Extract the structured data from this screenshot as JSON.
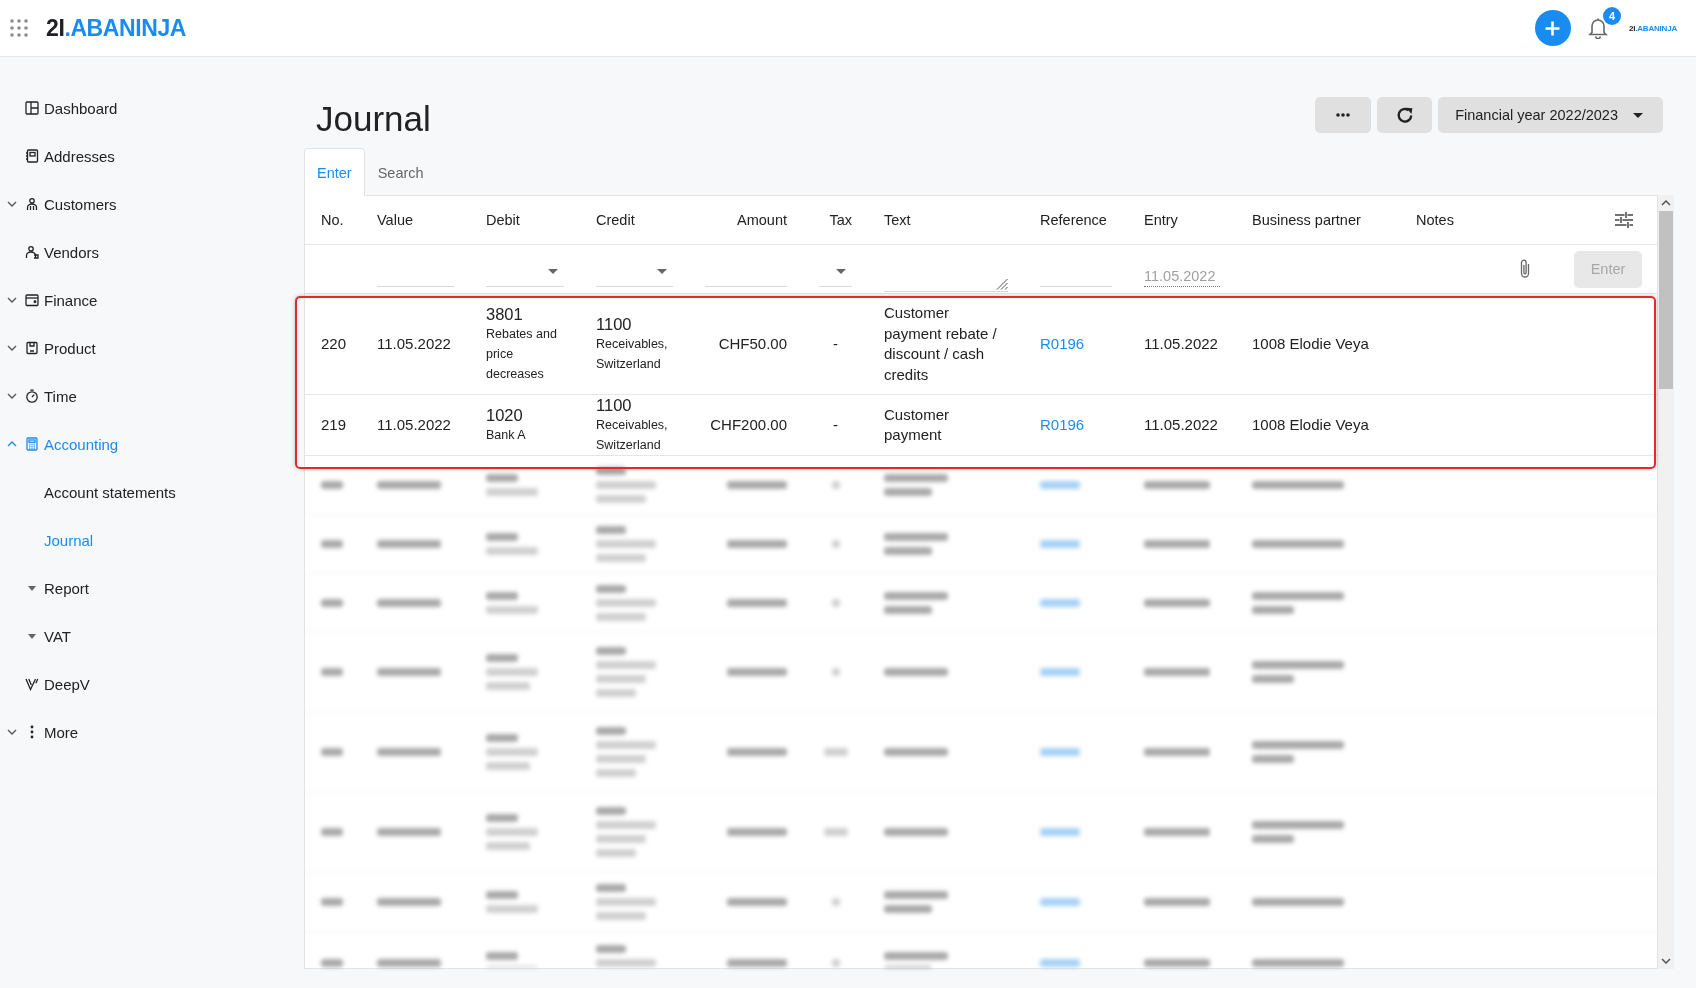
{
  "top_bar": {
    "logo": {
      "prefix": "2I",
      "suffix": ".ABANINJA"
    },
    "notification_count": "4",
    "account_logo": {
      "prefix": "2I",
      "suffix": ".ABANINJA"
    }
  },
  "sidebar": {
    "items": [
      {
        "kind": "link",
        "label": "Dashboard",
        "selected": false
      },
      {
        "kind": "link",
        "label": "Addresses",
        "selected": false
      },
      {
        "kind": "group",
        "label": "Customers",
        "expanded": false,
        "selected": false
      },
      {
        "kind": "link",
        "label": "Vendors",
        "selected": false
      },
      {
        "kind": "group",
        "label": "Finance",
        "expanded": false,
        "selected": false
      },
      {
        "kind": "group",
        "label": "Product",
        "expanded": false,
        "selected": false
      },
      {
        "kind": "group",
        "label": "Time",
        "expanded": false,
        "selected": false
      },
      {
        "kind": "group",
        "label": "Accounting",
        "expanded": true,
        "selected": true,
        "children": [
          {
            "kind": "link",
            "label": "Account statements",
            "selected": false
          },
          {
            "kind": "link",
            "label": "Journal",
            "selected": true
          },
          {
            "kind": "group",
            "label": "Report",
            "expanded": false,
            "selected": false
          },
          {
            "kind": "group",
            "label": "VAT",
            "expanded": false,
            "selected": false
          }
        ]
      },
      {
        "kind": "link",
        "label": "DeepV",
        "selected": false
      },
      {
        "kind": "group",
        "label": "More",
        "expanded": false,
        "selected": false
      }
    ]
  },
  "page": {
    "title": "Journal",
    "financial_year": "Financial year 2022/2023"
  },
  "tabs": [
    {
      "label": "Enter",
      "selected": true
    },
    {
      "label": "Search",
      "selected": false
    }
  ],
  "table": {
    "columns": [
      "No.",
      "Value",
      "Debit",
      "Credit",
      "Amount",
      "Tax",
      "Text",
      "Reference",
      "Entry",
      "Business partner",
      "Notes"
    ],
    "entry_row": {
      "fields": [
        {
          "kind": "blank"
        },
        {
          "kind": "text"
        },
        {
          "kind": "select"
        },
        {
          "kind": "select"
        },
        {
          "kind": "text"
        },
        {
          "kind": "select"
        },
        {
          "kind": "textarea"
        },
        {
          "kind": "text"
        },
        {
          "kind": "date",
          "placeholder": "11.05.2022"
        },
        {
          "kind": "blank"
        },
        {
          "kind": "attachment"
        }
      ],
      "submit": {
        "label": "Enter",
        "disabled": true
      }
    },
    "highlight_frame": true,
    "rows": [
      {
        "number": "220",
        "value_date": "11.05.2022",
        "debit": {
          "account": "3801",
          "name": "Rebates and price decreases"
        },
        "credit": {
          "account": "1100",
          "name": "Receivables, Switzerland"
        },
        "amount": "CHF50.00",
        "tax": "-",
        "text": "Customer payment rebate / discount / cash credits",
        "reference": "R0196",
        "entry_date": "11.05.2022",
        "business_partner": "1008 Elodie Veya"
      },
      {
        "number": "219",
        "value_date": "11.05.2022",
        "debit": {
          "account": "1020",
          "name": "Bank A"
        },
        "credit": {
          "account": "1100",
          "name": "Receivables, Switzerland"
        },
        "amount": "CHF200.00",
        "tax": "-",
        "text": "Customer payment",
        "reference": "R0196",
        "entry_date": "11.05.2022",
        "business_partner": "1008 Elodie Veya"
      }
    ]
  }
}
